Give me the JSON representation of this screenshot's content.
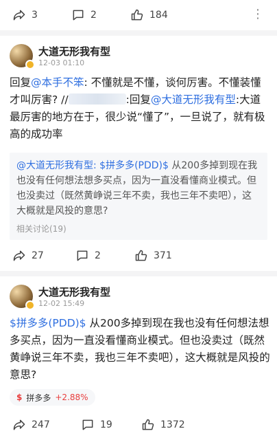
{
  "post1": {
    "actions": {
      "repost_count": "3",
      "comment_count": "2",
      "like_count": "184"
    },
    "more": "⋮"
  },
  "comment1": {
    "user": "大道无形我有型",
    "time": "12-03 01:10",
    "reply_prefix": "回复",
    "mention1": "@本手不笨",
    "text1": ": 不懂就是不懂，谈何厉害。不懂装懂才叫厉害? //",
    "text2": ":回复",
    "mention2": "@大道无形我有型",
    "text3": ":大道最厉害的地方在于，很少说“懂了”，一旦说了，就有极高的成功率",
    "quote": {
      "mention": "@大道无形我有型",
      "sep": ": ",
      "stock": "$拼多多(PDD)$",
      "text": " 从200多掉到现在我也没有任何想法想多买点，因为一直没看懂商业模式。但也没卖过（既然黄峥说三年不卖，我也三年不卖吧），这大概就是风投的意思?",
      "related": "相关讨论(19)"
    },
    "actions": {
      "repost_count": "27",
      "comment_count": "2",
      "like_count": "371"
    }
  },
  "comment2": {
    "user": "大道无形我有型",
    "time": "12-02 15:49",
    "stock": "$拼多多(PDD)$",
    "text": " 从200多掉到现在我也没有任何想法想多买点，因为一直没看懂商业模式。但也没卖过（既然黄峥说三年不卖，我也三年不卖吧），这大概就是风投的意思?",
    "chip": {
      "symbol": "$",
      "name": "拼多多",
      "change": "+2.88%"
    },
    "actions": {
      "repost_count": "247",
      "comment_count": "19",
      "like_count": "1372"
    }
  },
  "colors": {
    "link": "#2f6fe0",
    "up": "#e83c3c"
  }
}
